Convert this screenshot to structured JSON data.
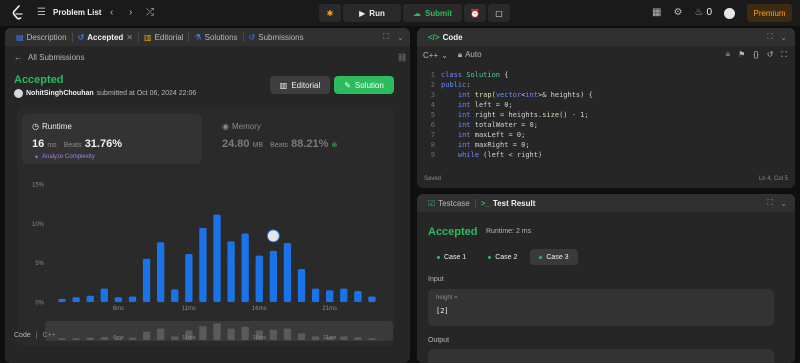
{
  "topbar": {
    "problem_list": "Problem List",
    "run": "Run",
    "submit": "Submit",
    "streak": "0",
    "premium": "Premium"
  },
  "left": {
    "tabs": [
      {
        "label": "Description",
        "icon": "doc-icon"
      },
      {
        "label": "Accepted",
        "icon": "history-icon"
      },
      {
        "label": "Editorial",
        "icon": "book-icon"
      },
      {
        "label": "Solutions",
        "icon": "flask-icon"
      },
      {
        "label": "Submissions",
        "icon": "history-icon"
      }
    ],
    "all_submissions": "All Submissions",
    "status": "Accepted",
    "user": "NohitSinghChouhan",
    "submitted": "submitted at Oct 06, 2024 22:06",
    "editorial_btn": "Editorial",
    "solution_btn": "Solution",
    "runtime_label": "Runtime",
    "runtime_value": "16",
    "runtime_unit": "ms",
    "runtime_beats_label": "Beats",
    "runtime_beats": "31.76%",
    "analyze": "Analyze Complexity",
    "memory_label": "Memory",
    "memory_value": "24.80",
    "memory_unit": "MB",
    "memory_beats_label": "Beats",
    "memory_beats": "88.21%",
    "code_label": "Code",
    "code_lang": "C++"
  },
  "chart_data": {
    "type": "bar",
    "y_ticks": [
      "15%",
      "10%",
      "5%",
      "0%"
    ],
    "ylim": [
      0,
      15
    ],
    "x_ticks": [
      "6ms",
      "11ms",
      "16ms",
      "21ms"
    ],
    "values": [
      0.4,
      0.6,
      0.8,
      1.7,
      0.6,
      0.7,
      5.5,
      7.6,
      1.6,
      6.1,
      9.4,
      11.1,
      7.7,
      8.7,
      5.9,
      6.5,
      7.5,
      4.2,
      1.7,
      1.5,
      1.7,
      1.4,
      0.7
    ],
    "highlight_index": 15,
    "overview_values": [
      0.3,
      0.3,
      0.4,
      0.5,
      0.3,
      0.4,
      1.4,
      1.9,
      0.6,
      1.6,
      2.3,
      2.8,
      1.9,
      2.2,
      1.6,
      1.7,
      1.9,
      1.1,
      0.6,
      0.5,
      0.6,
      0.5,
      0.3
    ],
    "overview_x_ticks": [
      "6ms",
      "11ms",
      "16ms",
      "21ms"
    ],
    "bar_color": "#1a73e8",
    "grid": true
  },
  "code": {
    "tab": "Code",
    "lang": "C++",
    "auto": "Auto",
    "lines": [
      "class Solution {",
      "public:",
      "    int trap(vector<int>& heights) {",
      "    int left = 0;",
      "    int right = heights.size() - 1;",
      "    int totalWater = 0;",
      "    int maxLeft = 0;",
      "    int maxRight = 0;",
      "    while (left < right)"
    ],
    "status": "Saved",
    "position": "Ln 4, Col 5"
  },
  "test": {
    "testcase_tab": "Testcase",
    "result_tab": "Test Result",
    "status": "Accepted",
    "runtime": "Runtime: 2 ms",
    "cases": [
      "Case 1",
      "Case 2",
      "Case 3"
    ],
    "input_label": "Input",
    "param_name": "height =",
    "param_value": "[2]",
    "output_label": "Output"
  },
  "colors": {
    "accent_green": "#2cbb5d",
    "bar_blue": "#1a73e8",
    "premium": "#ffa116",
    "purple": "#a37bf2"
  }
}
